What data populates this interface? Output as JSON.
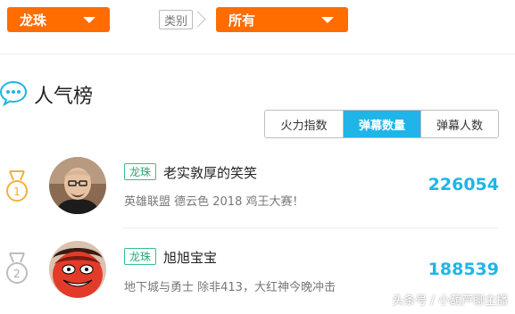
{
  "filters": {
    "game_dropdown": {
      "value": "龙珠"
    },
    "category_label": "类别",
    "category_dropdown": {
      "value": "所有"
    }
  },
  "section": {
    "title": "人气榜",
    "icon": "chat-bubble-icon"
  },
  "tabs": [
    {
      "label": "火力指数",
      "active": false
    },
    {
      "label": "弹幕数量",
      "active": true
    },
    {
      "label": "弹幕人数",
      "active": false
    }
  ],
  "ranking": [
    {
      "rank": "1",
      "tag": "龙珠",
      "name": "老实敦厚的笑笑",
      "room_title": "英雄联盟 德云色 2018 鸡王大赛！",
      "count": "226054"
    },
    {
      "rank": "2",
      "tag": "龙珠",
      "name": "旭旭宝宝",
      "room_title": "地下城与勇士 除非413，大红神今晚冲击",
      "count": "188539"
    }
  ],
  "colors": {
    "accent_orange": "#ff6c00",
    "accent_blue": "#1fb5e8",
    "tag_green": "#34c28d",
    "gold_medal": "#f3b13c",
    "silver_medal": "#bdbdbd"
  },
  "watermark": "头条号 / 小葫芦聊主播"
}
